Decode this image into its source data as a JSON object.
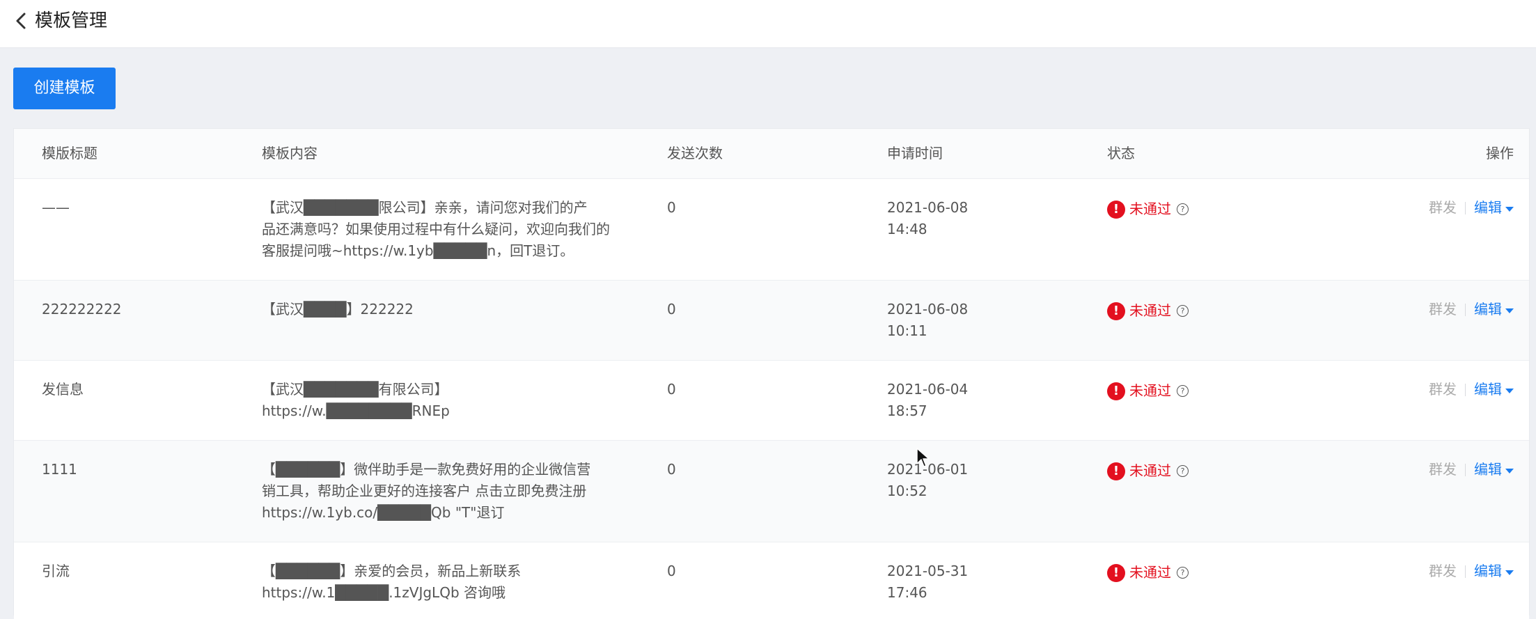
{
  "header": {
    "title": "模板管理",
    "back_icon": "chevron-left-icon"
  },
  "toolbar": {
    "create_label": "创建模板"
  },
  "table": {
    "columns": [
      "模版标题",
      "模板内容",
      "发送次数",
      "申请时间",
      "状态",
      "操作"
    ],
    "rows": [
      {
        "title": "——",
        "content": "【武汉███████限公司】亲亲，请问您对我们的产\n品还满意吗？如果使用过程中有什么疑问，欢迎向我们的\n客服提问哦~https://w.1yb█████n，回T退订。",
        "count": "0",
        "time": "2021-06-08\n14:48",
        "status": "未通过",
        "op_mass": "群发",
        "op_edit": "编辑"
      },
      {
        "title": "222222222",
        "content": "【武汉████】222222",
        "count": "0",
        "time": "2021-06-08\n10:11",
        "status": "未通过",
        "op_mass": "群发",
        "op_edit": "编辑"
      },
      {
        "title": "发信息",
        "content": "【武汉███████有限公司】\nhttps://w.████████RNEp",
        "count": "0",
        "time": "2021-06-04\n18:57",
        "status": "未通过",
        "op_mass": "群发",
        "op_edit": "编辑"
      },
      {
        "title": "1111",
        "content": "【██████】微伴助手是一款免费好用的企业微信营\n销工具，帮助企业更好的连接客户 点击立即免费注册\nhttps://w.1yb.co/█████Qb \"T\"退订",
        "count": "0",
        "time": "2021-06-01\n10:52",
        "status": "未通过",
        "op_mass": "群发",
        "op_edit": "编辑"
      },
      {
        "title": "引流",
        "content": "【██████】亲爱的会员，新品上新联系\nhttps://w.1█████.1zVJgLQb 咨询哦",
        "count": "0",
        "time": "2021-05-31\n17:46",
        "status": "未通过",
        "op_mass": "群发",
        "op_edit": "编辑"
      }
    ]
  },
  "icons": {
    "status": "error-icon",
    "help": "help-icon",
    "dropdown": "caret-down-icon"
  },
  "colors": {
    "accent": "#1a7cf0",
    "error": "#e3101f",
    "background": "#eef0f4"
  }
}
